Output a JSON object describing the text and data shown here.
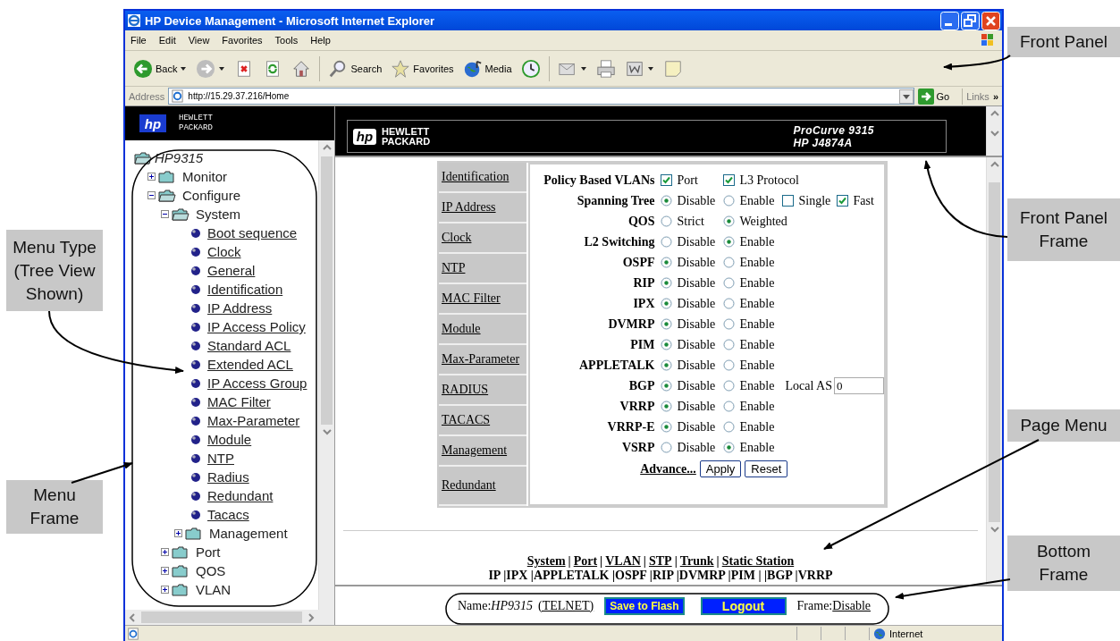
{
  "window": {
    "title": "HP Device Management - Microsoft Internet Explorer"
  },
  "menu_bar": [
    "File",
    "Edit",
    "View",
    "Favorites",
    "Tools",
    "Help"
  ],
  "toolbar": [
    {
      "kind": "back",
      "label": "Back",
      "has_menu": true
    },
    {
      "kind": "forward",
      "has_menu": true
    },
    {
      "kind": "stop",
      "has_menu": false
    },
    {
      "kind": "refresh",
      "has_menu": false
    },
    {
      "kind": "home",
      "has_menu": false
    },
    {
      "kind": "search",
      "label": "Search",
      "has_menu": false
    },
    {
      "kind": "favorites",
      "label": "Favorites",
      "has_menu": false
    },
    {
      "kind": "media",
      "label": "Media",
      "has_menu": false
    },
    {
      "kind": "history",
      "has_menu": false
    },
    {
      "kind": "mail",
      "has_menu": true
    },
    {
      "kind": "print",
      "has_menu": false
    },
    {
      "kind": "edit",
      "has_menu": true
    },
    {
      "kind": "note",
      "has_menu": false
    }
  ],
  "address_bar": {
    "label": "Address",
    "value": "http://15.29.37.216/Home",
    "go": "Go",
    "links": "Links",
    "more": "»"
  },
  "menu_frame": {
    "logo": "hp",
    "brand": [
      "HEWLETT",
      "PACKARD"
    ],
    "tree": [
      {
        "label": "HP9315",
        "kind": "root",
        "expanded": true,
        "children": [
          {
            "label": "Monitor",
            "kind": "folder",
            "expanded": false
          },
          {
            "label": "Configure",
            "kind": "folder",
            "expanded": true,
            "children": [
              {
                "label": "System",
                "kind": "folder",
                "expanded": true,
                "children": [
                  {
                    "label": "Boot sequence",
                    "kind": "page"
                  },
                  {
                    "label": "Clock",
                    "kind": "page"
                  },
                  {
                    "label": "General",
                    "kind": "page"
                  },
                  {
                    "label": "Identification",
                    "kind": "page"
                  },
                  {
                    "label": "IP Address",
                    "kind": "page"
                  },
                  {
                    "label": "IP Access Policy",
                    "kind": "page"
                  },
                  {
                    "label": "Standard ACL",
                    "kind": "page"
                  },
                  {
                    "label": "Extended ACL",
                    "kind": "page"
                  },
                  {
                    "label": "IP Access Group",
                    "kind": "page"
                  },
                  {
                    "label": "MAC Filter",
                    "kind": "page"
                  },
                  {
                    "label": "Max-Parameter",
                    "kind": "page"
                  },
                  {
                    "label": "Module",
                    "kind": "page"
                  },
                  {
                    "label": "NTP",
                    "kind": "page"
                  },
                  {
                    "label": "Radius",
                    "kind": "page"
                  },
                  {
                    "label": "Redundant",
                    "kind": "page"
                  },
                  {
                    "label": "Tacacs",
                    "kind": "page"
                  },
                  {
                    "label": "Management",
                    "kind": "folder",
                    "expanded": false
                  }
                ]
              },
              {
                "label": "Port",
                "kind": "folder",
                "expanded": false
              },
              {
                "label": "QOS",
                "kind": "folder",
                "expanded": false
              },
              {
                "label": "VLAN",
                "kind": "folder",
                "expanded": false
              }
            ]
          }
        ]
      }
    ]
  },
  "front_panel": {
    "logo": "hp",
    "brand": [
      "HEWLETT",
      "PACKARD"
    ],
    "model": [
      "ProCurve 9315",
      "HP J4874A"
    ]
  },
  "main_frame": {
    "page_menu": [
      "Identification",
      "IP Address",
      "Clock",
      "NTP",
      "MAC Filter",
      "Module",
      "Max-Parameter",
      "RADIUS",
      "TACACS",
      "Management",
      "Redundant"
    ],
    "settings": [
      {
        "label": "Policy Based VLANs",
        "options": [
          {
            "kind": "check",
            "label": "Port",
            "checked": true
          },
          {
            "kind": "check",
            "label": "L3 Protocol",
            "checked": true
          }
        ]
      },
      {
        "label": "Spanning Tree",
        "options": [
          {
            "kind": "radio",
            "label": "Disable",
            "selected": true
          },
          {
            "kind": "radio",
            "label": "Enable",
            "selected": false
          },
          {
            "kind": "check",
            "label": "Single",
            "checked": false
          },
          {
            "kind": "check",
            "label": "Fast",
            "checked": true
          }
        ]
      },
      {
        "label": "QOS",
        "options": [
          {
            "kind": "radio",
            "label": "Strict",
            "selected": false
          },
          {
            "kind": "radio",
            "label": "Weighted",
            "selected": true
          }
        ]
      },
      {
        "label": "L2 Switching",
        "options": [
          {
            "kind": "radio",
            "label": "Disable",
            "selected": false
          },
          {
            "kind": "radio",
            "label": "Enable",
            "selected": true
          }
        ]
      },
      {
        "label": "OSPF",
        "options": [
          {
            "kind": "radio",
            "label": "Disable",
            "selected": true
          },
          {
            "kind": "radio",
            "label": "Enable",
            "selected": false
          }
        ]
      },
      {
        "label": "RIP",
        "options": [
          {
            "kind": "radio",
            "label": "Disable",
            "selected": true
          },
          {
            "kind": "radio",
            "label": "Enable",
            "selected": false
          }
        ]
      },
      {
        "label": "IPX",
        "options": [
          {
            "kind": "radio",
            "label": "Disable",
            "selected": true
          },
          {
            "kind": "radio",
            "label": "Enable",
            "selected": false
          }
        ]
      },
      {
        "label": "DVMRP",
        "options": [
          {
            "kind": "radio",
            "label": "Disable",
            "selected": true
          },
          {
            "kind": "radio",
            "label": "Enable",
            "selected": false
          }
        ]
      },
      {
        "label": "PIM",
        "options": [
          {
            "kind": "radio",
            "label": "Disable",
            "selected": true
          },
          {
            "kind": "radio",
            "label": "Enable",
            "selected": false
          }
        ]
      },
      {
        "label": "APPLETALK",
        "options": [
          {
            "kind": "radio",
            "label": "Disable",
            "selected": true
          },
          {
            "kind": "radio",
            "label": "Enable",
            "selected": false
          }
        ]
      },
      {
        "label": "BGP",
        "options": [
          {
            "kind": "radio",
            "label": "Disable",
            "selected": true
          },
          {
            "kind": "radio",
            "label": "Enable",
            "selected": false
          }
        ],
        "field": {
          "label": "Local AS",
          "value": "0"
        }
      },
      {
        "label": "VRRP",
        "options": [
          {
            "kind": "radio",
            "label": "Disable",
            "selected": true
          },
          {
            "kind": "radio",
            "label": "Enable",
            "selected": false
          }
        ]
      },
      {
        "label": "VRRP-E",
        "options": [
          {
            "kind": "radio",
            "label": "Disable",
            "selected": true
          },
          {
            "kind": "radio",
            "label": "Enable",
            "selected": false
          }
        ]
      },
      {
        "label": "VSRP",
        "options": [
          {
            "kind": "radio",
            "label": "Disable",
            "selected": false
          },
          {
            "kind": "radio",
            "label": "Enable",
            "selected": true
          }
        ]
      }
    ],
    "advance_link": "Advance...",
    "buttons": [
      "Apply",
      "Reset"
    ],
    "nav_links": {
      "items": [
        "System",
        "Port",
        "VLAN",
        "STP",
        "Trunk",
        "Static Station"
      ],
      "separator": "|"
    },
    "nav_line_2": "IP |IPX |APPLETALK |OSPF |RIP |DVMRP |PIM | |BGP |VRRP"
  },
  "bottom_frame": {
    "name_label": "Name:",
    "name": "HP9315",
    "connection": "(TELNET)",
    "buttons": [
      "Save to Flash",
      "Logout"
    ],
    "frame_label": "Frame:",
    "frame_value": "Disable"
  },
  "status_bar": {
    "zone": "Internet"
  },
  "left_callouts": [
    "Menu Type\n(Tree View\nShown)",
    "Menu\nFrame"
  ],
  "right_callouts": [
    "Front Panel",
    "Front Panel\nFrame",
    "Page Menu",
    "Bottom\nFrame"
  ]
}
